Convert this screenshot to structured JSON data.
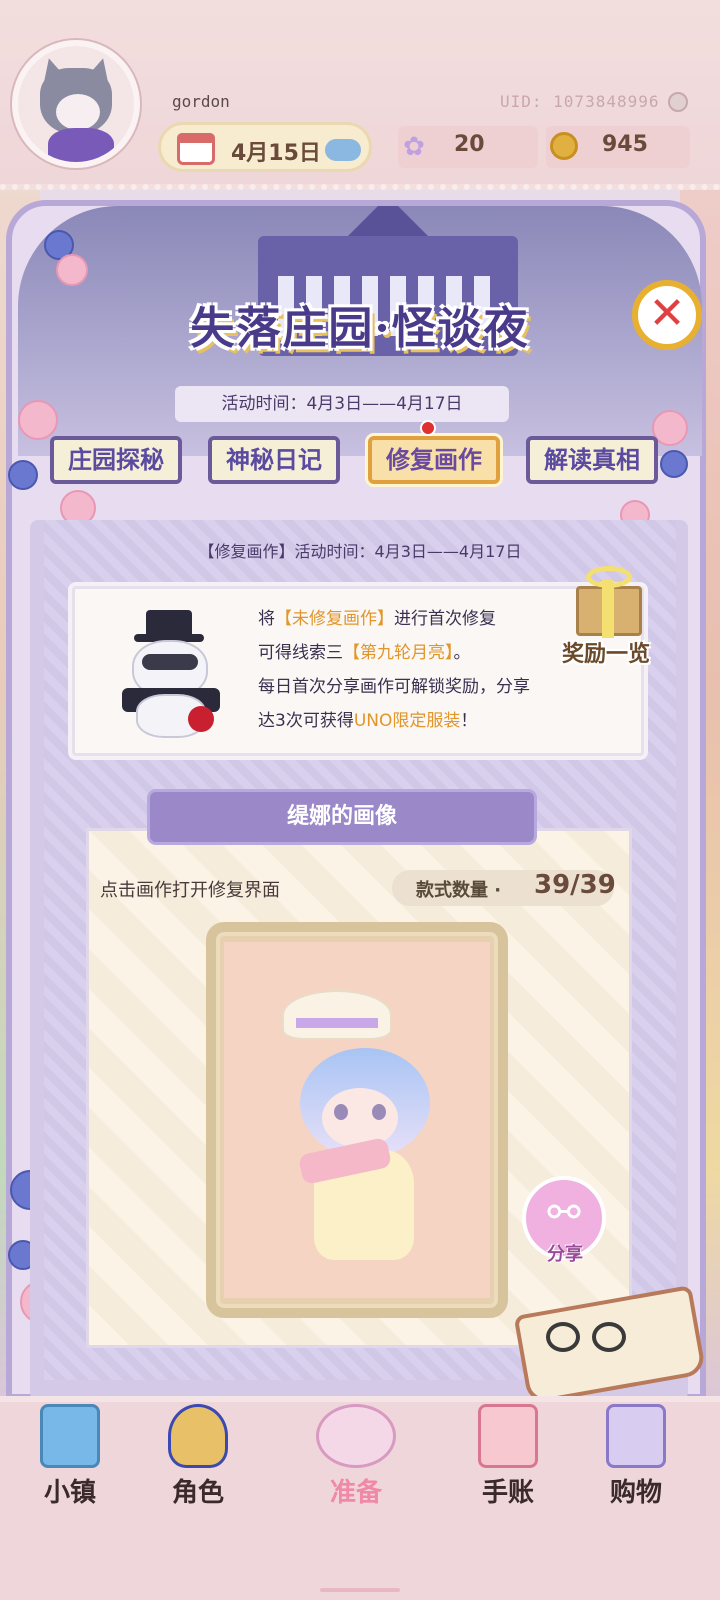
{
  "header": {
    "username": "gordon",
    "uid": "UID: 1073848996",
    "date": "4月15日",
    "gems": "20",
    "coins": "945"
  },
  "event": {
    "title": "失落庄园·怪谈夜",
    "time": "活动时间：4月3日——4月17日",
    "tabs": [
      "庄园探秘",
      "神秘日记",
      "修复画作",
      "解读真相"
    ],
    "active_tab": "修复画作"
  },
  "content": {
    "subtitle": "【修复画作】活动时间：4月3日——4月17日",
    "desc": {
      "line1_a": "将",
      "line1_b": "【未修复画作】",
      "line1_c": "进行首次修复",
      "line2_a": "可得线索三",
      "line2_b": "【第九轮月亮】",
      "line2_c": "。",
      "line3": "每日首次分享画作可解锁奖励，分享",
      "line4_a": "达3次可获得",
      "line4_b": "UNO限定服装",
      "line4_c": "！"
    },
    "reward_label": "奖励一览",
    "painting_title": "缇娜的画像",
    "hint": "点击画作打开修复界面",
    "count_label": "款式数量 ·",
    "count_value": "39/39",
    "share_label": "分享"
  },
  "nav": {
    "items": [
      "小镇",
      "角色",
      "准备",
      "手账",
      "购物"
    ],
    "active": "准备"
  }
}
